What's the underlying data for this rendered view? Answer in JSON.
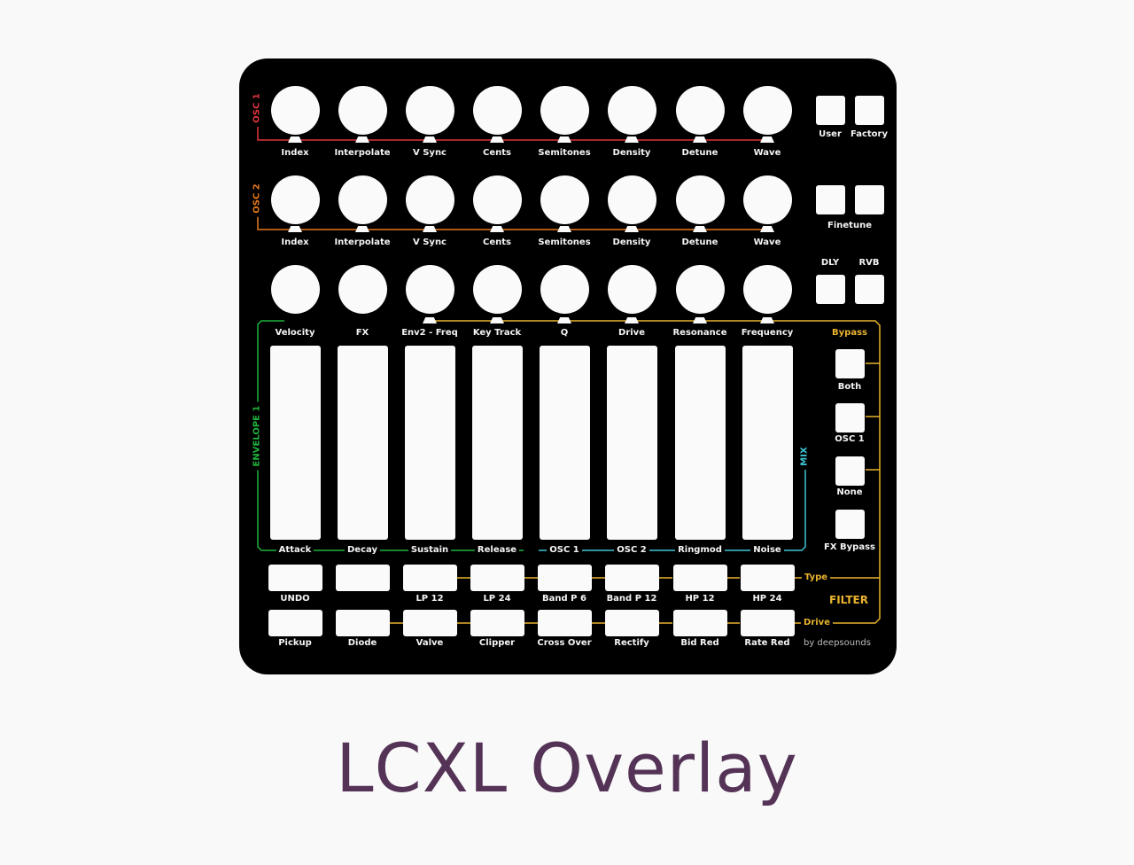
{
  "title": "LCXL Overlay",
  "credit": "by deepsounds",
  "colors": {
    "osc1": "#e0333d",
    "osc2": "#e8791c",
    "envelope": "#1db33c",
    "mix": "#3fc6d6",
    "filter": "#e8b32e",
    "panel": "#000000",
    "control": "#fafafa",
    "title": "#543357"
  },
  "groups": {
    "osc1": "OSC 1",
    "osc2": "OSC 2",
    "envelope": "ENVELOPE 1",
    "mix": "MIX",
    "bypass": "Bypass",
    "filter": "FILTER",
    "type": "Type",
    "drive": "Drive"
  },
  "knob_rows": [
    [
      "Index",
      "Interpolate",
      "V Sync",
      "Cents",
      "Semitones",
      "Density",
      "Detune",
      "Wave"
    ],
    [
      "Index",
      "Interpolate",
      "V Sync",
      "Cents",
      "Semitones",
      "Density",
      "Detune",
      "Wave"
    ],
    [
      "Velocity",
      "FX",
      "Env2 - Freq",
      "Key Track",
      "Q",
      "Drive",
      "Resonance",
      "Frequency"
    ]
  ],
  "faders": [
    "Attack",
    "Decay",
    "Sustain",
    "Release",
    "OSC 1",
    "OSC 2",
    "Ringmod",
    "Noise"
  ],
  "button_row1": [
    "UNDO",
    "",
    "LP 12",
    "LP 24",
    "Band P 6",
    "Band P 12",
    "HP 12",
    "HP 24"
  ],
  "button_row2": [
    "Pickup",
    "Diode",
    "Valve",
    "Clipper",
    "Cross Over",
    "Rectify",
    "Bid Red",
    "Rate Red"
  ],
  "side": {
    "row1": {
      "labels": [
        "User",
        "Factory"
      ]
    },
    "row2": {
      "label": "Finetune"
    },
    "row3": {
      "labels": [
        "DLY",
        "RVB"
      ]
    },
    "bypass_buttons": [
      "Both",
      "OSC 1",
      "None",
      "FX Bypass"
    ]
  }
}
